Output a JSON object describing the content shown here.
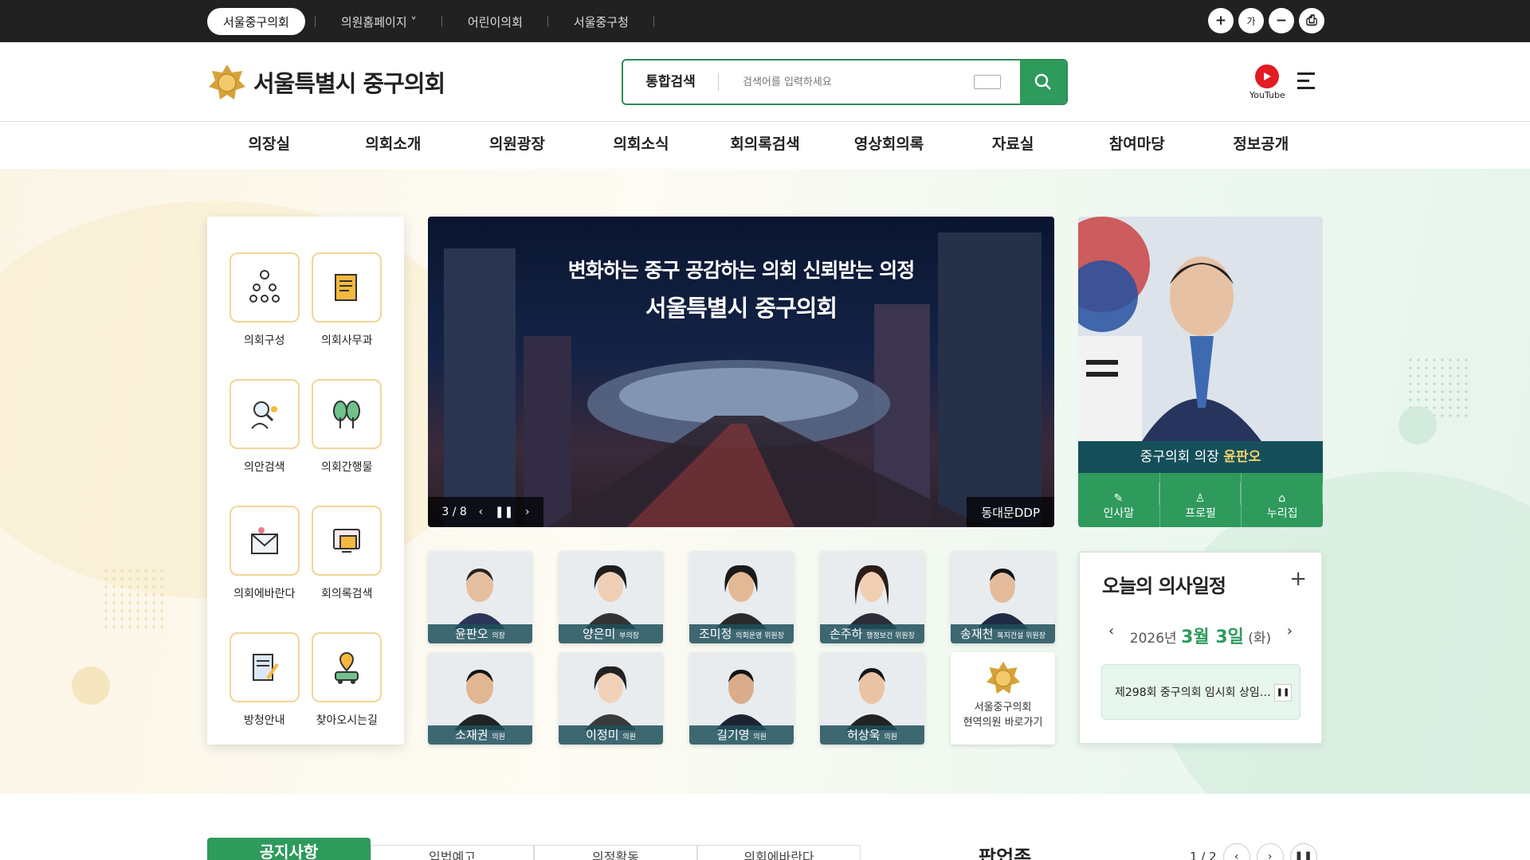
{
  "topbar": {
    "links": [
      {
        "label": "서울중구의회",
        "active": true
      },
      {
        "label": "의원홈페이지 ˅",
        "active": false
      },
      {
        "label": "어린이의회",
        "active": false
      },
      {
        "label": "서울중구청",
        "active": false
      }
    ],
    "buttons": [
      {
        "icon": "zoom-in-icon",
        "label": "+"
      },
      {
        "icon": "font-icon",
        "label": "가"
      },
      {
        "icon": "zoom-out-icon",
        "label": "−"
      },
      {
        "icon": "print-icon",
        "label": "⎙"
      }
    ]
  },
  "header": {
    "logo_text": "서울특별시 중구의회",
    "search_category": "통합검색",
    "search_placeholder": "검색어를 입력하세요",
    "youtube_label": "YouTube"
  },
  "gnb": [
    "의장실",
    "의회소개",
    "의원광장",
    "의회소식",
    "회의록검색",
    "영상회의록",
    "자료실",
    "참여마당",
    "정보공개"
  ],
  "quick_menu": [
    {
      "label": "의회구성",
      "icon": "org-chart-icon"
    },
    {
      "label": "의회사무과",
      "icon": "document-icon"
    },
    {
      "label": "의안검색",
      "icon": "search-person-icon"
    },
    {
      "label": "의회간행물",
      "icon": "trees-icon"
    },
    {
      "label": "의회에바란다",
      "icon": "mail-icon"
    },
    {
      "label": "회의록검색",
      "icon": "folder-icon"
    },
    {
      "label": "방청안내",
      "icon": "notepad-icon"
    },
    {
      "label": "찾아오시는길",
      "icon": "map-car-icon"
    }
  ],
  "slider": {
    "headline": "변화하는 중구 공감하는 의회 신뢰받는 의정",
    "subtitle": "서울특별시 중구의회",
    "counter": "3 / 8",
    "caption": "동대문DDP"
  },
  "chair": {
    "title_prefix": "중구의회 의장",
    "name": "윤판오",
    "buttons": [
      {
        "label": "인사말",
        "icon": "edit-icon"
      },
      {
        "label": "프로필",
        "icon": "user-icon"
      },
      {
        "label": "누리집",
        "icon": "home-icon"
      }
    ]
  },
  "members": [
    {
      "name": "윤판오",
      "role": "의장"
    },
    {
      "name": "양은미",
      "role": "부의장"
    },
    {
      "name": "조미정",
      "role": "의회운영 위원장"
    },
    {
      "name": "손주하",
      "role": "행정보건 위원장"
    },
    {
      "name": "송재천",
      "role": "복지건설 위원장"
    },
    {
      "name": "소재권",
      "role": "의원"
    },
    {
      "name": "이정미",
      "role": "의원"
    },
    {
      "name": "길기영",
      "role": "의원"
    },
    {
      "name": "허상욱",
      "role": "의원"
    }
  ],
  "members_link": {
    "line1": "서울중구의회",
    "line2": "현역의원 바로가기"
  },
  "schedule": {
    "title": "오늘의 의사일정",
    "year": "2026년",
    "date": "3월 3일",
    "weekday": "(화)",
    "item": "제298회 중구의회 임시회 상임…"
  },
  "bottom": {
    "active_tab": "공지사항",
    "tabs": [
      "입법예고",
      "의정활동",
      "의회에바란다"
    ],
    "popup_title": "팝업존",
    "popup_counter": "1 / 2"
  }
}
